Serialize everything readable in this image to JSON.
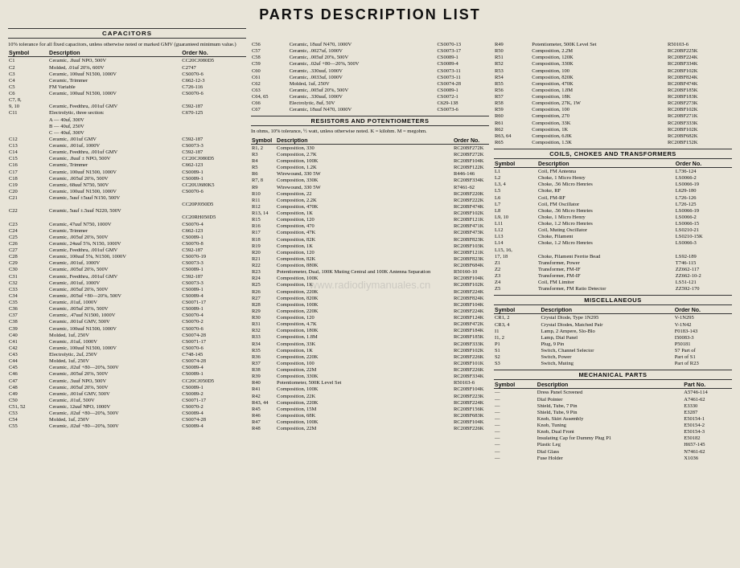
{
  "title": "PARTS DESCRIPTION LIST",
  "watermark": "www.radiodiymanuales.cn",
  "col1": {
    "section": "CAPACITORS",
    "note": "10% tolerance for all fixed capacitors, unless otherwise noted or marked GMV (guaranteed minimum value.)",
    "headers": [
      "Symbol",
      "Description",
      "Order No."
    ],
    "rows": [
      [
        "C1",
        "Ceramic, .8uuf NPO, 500V",
        "CC20CJ080D5"
      ],
      [
        "C2",
        "Molded, .01uf 20%, 600V",
        "C2747"
      ],
      [
        "C3",
        "Ceramic, 100uuf N1500, 1000V",
        "CS0070-6"
      ],
      [
        "C4",
        "Ceramic, Trimmer",
        "C662-12-3"
      ],
      [
        "C5",
        "FM Variable",
        "C726-116"
      ],
      [
        "C6",
        "Ceramic, 100uuf N1500, 1000V",
        "CS0070-6"
      ],
      [
        "C7, 8,",
        "",
        ""
      ],
      [
        "9, 10",
        "Ceramic, Feedthru, .001uf GMV",
        "C592-187"
      ],
      [
        "C11",
        "Electrolytic, three section:",
        "C670-125"
      ],
      [
        "",
        "A — 40uf, 300V",
        ""
      ],
      [
        "",
        "B — 40uf, 250V",
        ""
      ],
      [
        "",
        "C — 40uf, 300V",
        ""
      ],
      [
        "C12",
        "Ceramic, .001uf GMV",
        "C592-187"
      ],
      [
        "C13",
        "Ceramic, .001uf, 1000V",
        "CS0073-3"
      ],
      [
        "C14",
        "Ceramic, Feedthru, .001uf GMV",
        "C592-187"
      ],
      [
        "C15",
        "Ceramic, .8uuf ± NPO, 500V",
        "CC20CJ080D5"
      ],
      [
        "C16",
        "Ceramic, Trimmer",
        "C662-123"
      ],
      [
        "C17",
        "Ceramic, 100uuf N1500, 1000V",
        "CS0089-1"
      ],
      [
        "C18",
        "Ceramic, .005uf 20%, 500V",
        "CS0089-1"
      ],
      [
        "C19",
        "Ceramic, 68uuf N750, 500V",
        "CC20UJ680K5"
      ],
      [
        "C20",
        "Ceramic, 100uuf N1500, 1000V",
        "CS0070-6"
      ],
      [
        "C21",
        "Ceramic, 5uuf ±5uuf N150, 500V",
        ""
      ],
      [
        "",
        "",
        "CC20PJ050D5"
      ],
      [
        "C22",
        "Ceramic, 5uuf ±.5uuf N220, 500V",
        ""
      ],
      [
        "",
        "",
        "CC20RH050D5"
      ],
      [
        "C23",
        "Ceramic, 47uuf N750, 1000V",
        "CS0070-4"
      ],
      [
        "C24",
        "Ceramic, Trimmer",
        "C662-123"
      ],
      [
        "C25",
        "Ceramic, .005uf 20%, 500V",
        "CS0089-1"
      ],
      [
        "C26",
        "Ceramic, 24uuf 5%, N150, 1000V",
        "CS0070-8"
      ],
      [
        "C27",
        "Ceramic, Feedthru, .001uf GMV",
        "C592-187"
      ],
      [
        "C28",
        "Ceramic, 100uuf 5%, N1500, 1000V",
        "CS0070-19"
      ],
      [
        "C29",
        "Ceramic, .001uf, 1000V",
        "CS0073-3"
      ],
      [
        "C30",
        "Ceramic, .005uf 20%, 500V",
        "CS0089-1"
      ],
      [
        "C31",
        "Ceramic, Feedthru, .001uf GMV",
        "C592-187"
      ],
      [
        "C32",
        "Ceramic, .001uf, 1000V",
        "CS0073-3"
      ],
      [
        "C33",
        "Ceramic, .005uf 20%, 500V",
        "CS0089-1"
      ],
      [
        "C34",
        "Ceramic, .005uf +80—20%, 500V",
        "CS0089-4"
      ],
      [
        "C35",
        "Ceramic, .01uf, 1000V",
        "CS0071-17"
      ],
      [
        "C36",
        "Ceramic, .005uf 20%, 500V",
        "CS0089-1"
      ],
      [
        "C37",
        "Ceramic, .47uuf N1500, 1000V",
        "CS0070-4"
      ],
      [
        "C38",
        "Ceramic, .001uf GMV, 500V",
        "CS0070-2"
      ],
      [
        "C39",
        "Ceramic, 100uuf N1500, 1000V",
        "CS0070-6"
      ],
      [
        "C40",
        "Molded, 1uf, 250V",
        "CS0074-28"
      ],
      [
        "C41",
        "Ceramic, .01uf, 1000V",
        "CS0071-17"
      ],
      [
        "C42",
        "Ceramic, 100uuf N1500, 1000V",
        "CS0070-6"
      ],
      [
        "C43",
        "Electrolytic, 2uf, 250V",
        "C748-145"
      ],
      [
        "C44",
        "Molded, 1uf, 250V",
        "CS0074-28"
      ],
      [
        "C45",
        "Ceramic, .02uf +80—20%, 500V",
        "CS0089-4"
      ],
      [
        "C46",
        "Ceramic, .005uf 20%, 500V",
        "CS0089-1"
      ],
      [
        "C47",
        "Ceramic, .5uuf NPO, 500V",
        "CC20CJ050D5"
      ],
      [
        "C48",
        "Ceramic, .005uf 20%, 500V",
        "CS0089-1"
      ],
      [
        "C49",
        "Ceramic, .001uf GMV, 500V",
        "CS0089-2"
      ],
      [
        "C50",
        "Ceramic, .01uf, 500V",
        "CS0071-17"
      ],
      [
        "C51, 52",
        "Ceramic, 12uuf NPO, 1000V",
        "CS0070-2"
      ],
      [
        "C53",
        "Ceramic, .02uf +80—20%, 500V",
        "CS0089-4"
      ],
      [
        "C54",
        "Molded, 1uf, 250V",
        "CS0074-28"
      ],
      [
        "C55",
        "Ceramic, .02uf +80—20%, 500V",
        "CS0089-4"
      ]
    ]
  },
  "col2": {
    "rows_cap": [
      [
        "C56",
        "Ceramic, 18uuf N470, 1000V",
        "CS0070-13"
      ],
      [
        "C57",
        "Ceramic, .0027uf, 1000V",
        "CS0073-17"
      ],
      [
        "C58",
        "Ceramic, .005uf 20%, 500V",
        "CS0089-1"
      ],
      [
        "C59",
        "Ceramic, .02uf +80—20%, 500V",
        "CS0089-4"
      ],
      [
        "C60",
        "Ceramic, .330uuf, 1000V",
        "CS0073-11"
      ],
      [
        "C61",
        "Ceramic, .0033uf, 1000V",
        "CS0073-11"
      ],
      [
        "C62",
        "Molded, 1uf, 250V",
        "CS0074-28"
      ],
      [
        "C63",
        "Ceramic, .005uf 20%, 500V",
        "CS0089-1"
      ],
      [
        "C64, 65",
        "Ceramic, .330uuf, 1000V",
        "CS0072-1"
      ],
      [
        "C66",
        "Electrolytic, 8uf, 50V",
        "C629-138"
      ],
      [
        "C67",
        "Ceramic, 18uuf N470, 1000V",
        "CS0073-6"
      ]
    ],
    "section_res": "RESISTORS AND POTENTIOMETERS",
    "note_res": "In ohms, 10% tolerance, ½ watt, unless otherwise noted. K = kilohm. M = megohm.",
    "headers_res": [
      "Symbol",
      "Description",
      "Order No."
    ],
    "rows_res": [
      [
        "R1, 2",
        "Composition, 330",
        "RC20BF272K"
      ],
      [
        "R3",
        "Composition, 2.7K",
        "RC20BF272K"
      ],
      [
        "R4",
        "Composition, 100K",
        "RC20BF104K"
      ],
      [
        "R5",
        "Composition, 1.2K",
        "RC20BF122K"
      ],
      [
        "R6",
        "Wirewound, 330 5W",
        "R446-146"
      ],
      [
        "R7, 8",
        "Composition, 330K",
        "RC20BF334K"
      ],
      [
        "R9",
        "Wirewound, 330 5W",
        "R7461-62"
      ],
      [
        "R10",
        "Composition, 22",
        "RC20BF220K"
      ],
      [
        "R11",
        "Composition, 2.2K",
        "RC20BF222K"
      ],
      [
        "R12",
        "Composition, 470K",
        "RC20BF474K"
      ],
      [
        "R13, 14",
        "Composition, 1K",
        "RC20BF102K"
      ],
      [
        "R15",
        "Composition, 120",
        "RC20BF121K"
      ],
      [
        "R16",
        "Composition, 470",
        "RC20BF471K"
      ],
      [
        "R17",
        "Composition, 47K",
        "RC20BF473K"
      ],
      [
        "R18",
        "Composition, 82K",
        "RC20BF823K"
      ],
      [
        "R19",
        "Composition, 1K",
        "RC20BF103K"
      ],
      [
        "R20",
        "Composition, 120",
        "RC20BF121K"
      ],
      [
        "R21",
        "Composition, 82K",
        "RC20BF823K"
      ],
      [
        "R22",
        "Composition, 880K",
        "RC20BF684K"
      ],
      [
        "R23",
        "Potentiometer, Dual, 100K Muting Central and 100K Antenna Separation",
        "R50160-10"
      ],
      [
        "R24",
        "Composition, 100K",
        "RC20BF104K"
      ],
      [
        "R25",
        "Composition, 1K",
        "RC20BF102K"
      ],
      [
        "R26",
        "Composition, 220K",
        "RC20BF224K"
      ],
      [
        "R27",
        "Composition, 820K",
        "RC20BF824K"
      ],
      [
        "R28",
        "Composition, 100K",
        "RC20BF104K"
      ],
      [
        "R29",
        "Composition, 220K",
        "RC20BF224K"
      ],
      [
        "R30",
        "Composition, 120",
        "RC20BF124K"
      ],
      [
        "R31",
        "Composition, 4.7K",
        "RC20BF472K"
      ],
      [
        "R32",
        "Composition, 180K",
        "RC20BF184K"
      ],
      [
        "R33",
        "Composition, 1.8M",
        "RC20BF185K"
      ],
      [
        "R34",
        "Composition, 33K",
        "RC20BF333K"
      ],
      [
        "R35",
        "Composition, 1K",
        "RC20BF102K"
      ],
      [
        "R36",
        "Composition, 220K",
        "RC20BF226K"
      ],
      [
        "R37",
        "Composition, 100",
        "RC20BF101K"
      ],
      [
        "R38",
        "Composition, 22M",
        "RC20BF226K"
      ],
      [
        "R39",
        "Composition, 330K",
        "RC20BF334K"
      ],
      [
        "R40",
        "Potentiometer, 500K Level Set",
        "R50103-6"
      ],
      [
        "R41",
        "Composition, 100K",
        "RC20BF104K"
      ],
      [
        "R42",
        "Composition, 22K",
        "RC20BF223K"
      ],
      [
        "R43, 44",
        "Composition, 220K",
        "RC20BF224K"
      ],
      [
        "R45",
        "Composition, 15M",
        "RC20BF156K"
      ],
      [
        "R46",
        "Composition, 68K",
        "RC20BF683K"
      ],
      [
        "R47",
        "Composition, 100K",
        "RC20BF104K"
      ],
      [
        "R48",
        "Composition, 22M",
        "RC20BF226K"
      ]
    ]
  },
  "col3": {
    "rows_res2": [
      [
        "R49",
        "Potentiometer, 500K Level Set",
        "R50103-6"
      ],
      [
        "R50",
        "Composition, 2.2M",
        "RC20BF225K"
      ],
      [
        "R51",
        "Composition, 120K",
        "RC20BF224K"
      ],
      [
        "R52",
        "Composition, 330K",
        "RC20BF334K"
      ],
      [
        "R53",
        "Composition, 100",
        "RC20BF102K"
      ],
      [
        "R54",
        "Composition, 820K",
        "RC20BF824K"
      ],
      [
        "R55",
        "Composition, 470K",
        "RC20BF474K"
      ],
      [
        "R56",
        "Composition, 1.8M",
        "RC20BF185K"
      ],
      [
        "R57",
        "Composition, 18K",
        "RC20BF183K"
      ],
      [
        "R58",
        "Composition, 27K, 1W",
        "RC20BF273K"
      ],
      [
        "R59",
        "Composition, 100",
        "RC20BF102K"
      ],
      [
        "R60",
        "Composition, 270",
        "RC20BF271K"
      ],
      [
        "R61",
        "Composition, 33K",
        "RC20BF333K"
      ],
      [
        "R62",
        "Composition, 1K",
        "RC20BF102K"
      ],
      [
        "R63, 64",
        "Composition, 6.8K",
        "RC20BF682K"
      ],
      [
        "R65",
        "Composition, 1.5K",
        "RC20BF152K"
      ]
    ],
    "section_coils": "COILS, CHOKES AND TRANSFORMERS",
    "headers_coils": [
      "Symbol",
      "Description",
      "Order No."
    ],
    "rows_coils": [
      [
        "L1",
        "Coil, FM Antenna",
        "L736-124"
      ],
      [
        "L2",
        "Choke, 1 Micro Henry",
        "LS0066-2"
      ],
      [
        "L3, 4",
        "Choke, .56 Micro Henries",
        "LS0066-19"
      ],
      [
        "L5",
        "Choke, RF",
        "L629-180"
      ],
      [
        "L6",
        "Coil, FM-RF",
        "L726-126"
      ],
      [
        "L7",
        "Coil, FM Oscillator",
        "L726-125"
      ],
      [
        "L8",
        "Choke, .56 Micro Henries",
        "LS0066-19"
      ],
      [
        "L9, 10",
        "Choke, 1 Micro Henry",
        "LS0066-2"
      ],
      [
        "L11",
        "Choke, 1.2 Micro Henries",
        "LS0066-15"
      ],
      [
        "L12",
        "Coil, Muting Oscillator",
        "LS0210-21"
      ],
      [
        "L13",
        "Choke, Filament",
        "LS0210-15K"
      ],
      [
        "L14",
        "Choke, 1.2 Micro Henries",
        "LS0066-3"
      ],
      [
        "L15, 16,",
        "",
        ""
      ],
      [
        "17, 18",
        "Choke, Filament Ferrite Bead",
        "LS92-189"
      ],
      [
        "Z1",
        "Transformer, Power",
        "T746-115"
      ],
      [
        "Z2",
        "Transformer, FM-IF",
        "ZZ662-117"
      ],
      [
        "Z3",
        "Transformer, FM-IF",
        "ZZ662-10-2"
      ],
      [
        "Z4",
        "Coil, FM Limiter",
        "LS51-121"
      ],
      [
        "Z5",
        "Transformer, FM Ratio Detector",
        "ZZ592-170"
      ]
    ],
    "section_misc": "MISCELLANEOUS",
    "headers_misc": [
      "Symbol",
      "Description",
      "Order No."
    ],
    "rows_misc": [
      [
        "CR1, 2",
        "Crystal Diode, Type 1N295",
        "V-1N295"
      ],
      [
        "CR3, 4",
        "Crystal Diodes, Matched Pair",
        "V-1N42"
      ],
      [
        "I1",
        "Lamp, 2 Ampere, Slo-Blo",
        "F0183-143"
      ],
      [
        "I1, 2",
        "Lamp, Dial Panel",
        "I50083-3"
      ],
      [
        "P1",
        "Plug, 9 Pin",
        "P50181"
      ],
      [
        "S1",
        "Switch, Channel Selector",
        "S7 Part of"
      ],
      [
        "S2",
        "Switch, Power",
        "Part of S1"
      ],
      [
        "S3",
        "Switch, Muting",
        "Part of R23"
      ]
    ],
    "section_mech": "MECHANICAL PARTS",
    "headers_mech": [
      "Symbol",
      "Description",
      "Part No."
    ],
    "rows_mech": [
      [
        "—",
        "Dress Panel Screened",
        "A5746-114"
      ],
      [
        "—",
        "Dial Pointer",
        "A7461-62"
      ],
      [
        "—",
        "Shield, Tube, 7 Pin",
        "E3330"
      ],
      [
        "—",
        "Shield, Tube, 9 Pin",
        "E3287"
      ],
      [
        "—",
        "Knob, Skirt Assembly",
        "E50154-1"
      ],
      [
        "—",
        "Knob, Tuning",
        "E50154-2"
      ],
      [
        "—",
        "Knob, Dual Front",
        "E50154-3"
      ],
      [
        "—",
        "Insulating Cap for Dummy Plug P1",
        "E50182"
      ],
      [
        "—",
        "Plastic Leg",
        "H657-145"
      ],
      [
        "—",
        "Dial Glass",
        "N7461-62"
      ],
      [
        "—",
        "Fuse Holder",
        "X1036"
      ]
    ]
  }
}
